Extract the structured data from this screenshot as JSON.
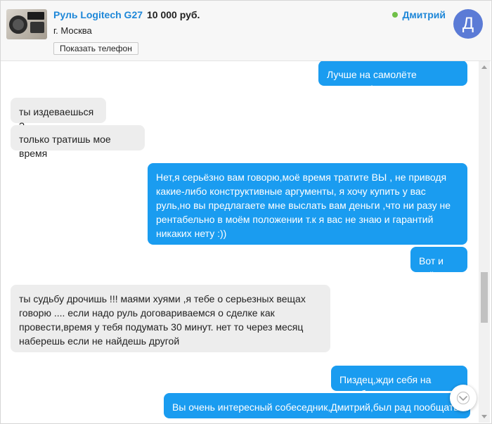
{
  "header": {
    "item_title": "Руль Logitech G27",
    "price": "10 000 руб.",
    "city": "г. Москва",
    "show_phone_label": "Показать телефон",
    "user_name": "Дмитрий",
    "user_status": "online",
    "avatar_letter": "Д",
    "colors": {
      "link": "#1e87d8",
      "avatar": "#5b7bd6",
      "online": "#70c048"
    }
  },
  "messages": [
    {
      "direction": "out",
      "text": "Лучше на самолёте ,согласен!"
    },
    {
      "direction": "in",
      "text": "ты издеваешься ?"
    },
    {
      "direction": "in",
      "text": "только тратишь мое время"
    },
    {
      "direction": "out",
      "text": "Нет,я серьёзно вам говорю,моё время тратите ВЫ , не приводя какие-либо конструктивные аргументы, я хочу купить у вас руль,но вы предлагаете мне выслать вам деньги ,что ни разу не рентабельно в моём положении т.к я вас не знаю и гарантий никаких нету :))"
    },
    {
      "direction": "out",
      "text": "Вот и всё"
    },
    {
      "direction": "in",
      "text": "ты судьбу дрочишь !!! маями хуями ,я тебе о серьезных вещах говорю ....  если надо руль договариваемся о сделке как провести,время у тебя подумать 30 минут. нет то  через месяц наберешь если не найдешь другой"
    },
    {
      "direction": "out",
      "text": "Пиздец,жди себя на пикабу"
    },
    {
      "direction": "out",
      "text": "Вы очень интересный собеседник,Дмитрий,был рад пообщаться"
    }
  ],
  "colors": {
    "outgoing_bubble": "#1a9cf0",
    "incoming_bubble": "#ededed"
  },
  "icons": {
    "scroll_down": "chevron-down-icon"
  }
}
